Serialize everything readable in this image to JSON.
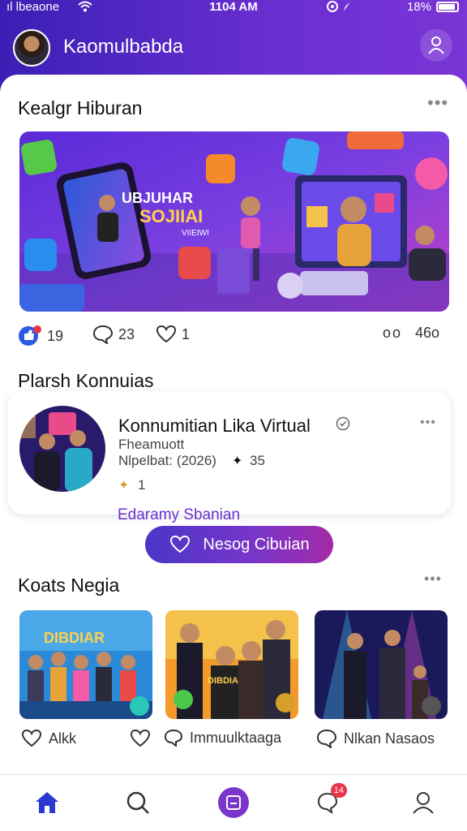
{
  "status_bar": {
    "carrier": "ıl lbeaone",
    "time": "1104 AM",
    "battery": "18%"
  },
  "header": {
    "title": "Kaomulbabda"
  },
  "feed_section": {
    "title": "Kealgr Hiburan"
  },
  "banner": {
    "phone_text_1": "UBJUHAR",
    "phone_text_2": "SOJIIAI",
    "phone_text_3": "VIIEIWI"
  },
  "stats": {
    "likes": "19",
    "comments": "23",
    "shares": "1",
    "views": "46o"
  },
  "communities_section": {
    "title": "Plarsh Konnuias"
  },
  "community": {
    "name": "Konnumitian Lika Virtual",
    "subtitle": "Fheamuott",
    "date_line": "Nlpelbat: (2026)",
    "member_count": "35",
    "reaction_count": "1",
    "link_text": "Edaramy Sbanian",
    "join_button": "Nesog Cibuian"
  },
  "popular_section": {
    "title": "Koats Negia"
  },
  "thumbnails": [
    {
      "caption_tag": "DIBDIAR",
      "action_label": "Alkk"
    },
    {
      "caption_tag": "DIBDIAR",
      "action_label": "Immuulktaaga"
    },
    {
      "caption_tag": "",
      "action_label": "Nlkan Nasaos"
    }
  ],
  "bottom_nav": {
    "notifications_badge": "14"
  },
  "colors": {
    "brand_gradient_start": "#3b1fb5",
    "brand_gradient_end": "#7b34d6",
    "accent": "#6a2fd0",
    "badge": "#e8344a"
  }
}
